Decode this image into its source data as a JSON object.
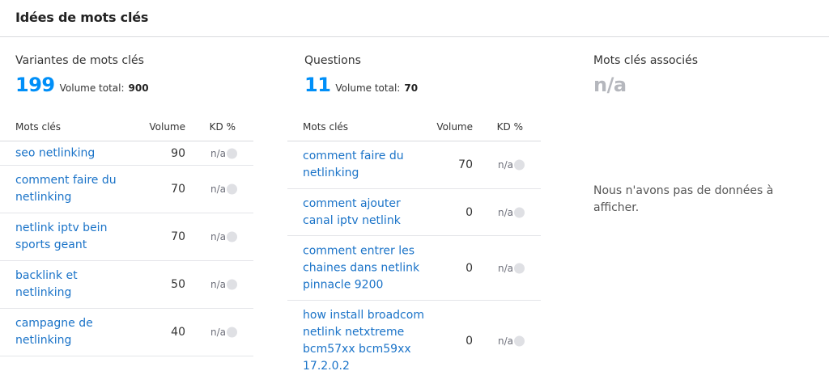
{
  "header": {
    "title": "Idées de mots clés"
  },
  "variants": {
    "title": "Variantes de mots clés",
    "count": "199",
    "volume_label": "Volume total:",
    "volume_value": "900",
    "table": {
      "headers": {
        "keyword": "Mots clés",
        "volume": "Volume",
        "kd": "KD %"
      },
      "rows": [
        {
          "keyword": "seo netlinking",
          "volume": "90",
          "kd": "n/a"
        },
        {
          "keyword": "comment faire du netlinking",
          "volume": "70",
          "kd": "n/a"
        },
        {
          "keyword": "netlink iptv bein sports geant",
          "volume": "70",
          "kd": "n/a"
        },
        {
          "keyword": "backlink et netlinking",
          "volume": "50",
          "kd": "n/a"
        },
        {
          "keyword": "campagne de netlinking",
          "volume": "40",
          "kd": "n/a"
        }
      ]
    }
  },
  "questions": {
    "title": "Questions",
    "count": "11",
    "volume_label": "Volume total:",
    "volume_value": "70",
    "table": {
      "headers": {
        "keyword": "Mots clés",
        "volume": "Volume",
        "kd": "KD %"
      },
      "rows": [
        {
          "keyword": "comment faire du netlinking",
          "volume": "70",
          "kd": "n/a"
        },
        {
          "keyword": "comment ajouter canal iptv netlink",
          "volume": "0",
          "kd": "n/a"
        },
        {
          "keyword": "comment entrer les chaines dans netlink pinnacle 9200",
          "volume": "0",
          "kd": "n/a"
        },
        {
          "keyword": "how install broadcom netlink netxtreme bcm57xx bcm59xx 17.2.0.2",
          "volume": "0",
          "kd": "n/a"
        }
      ]
    }
  },
  "related": {
    "title": "Mots clés associés",
    "count": "n/a",
    "empty_message": "Nous n'avons pas de données à afficher."
  },
  "colors": {
    "accent": "#008ff8",
    "link": "#1a73c8",
    "muted": "#b5b7bd",
    "divider": "#d9dade"
  }
}
